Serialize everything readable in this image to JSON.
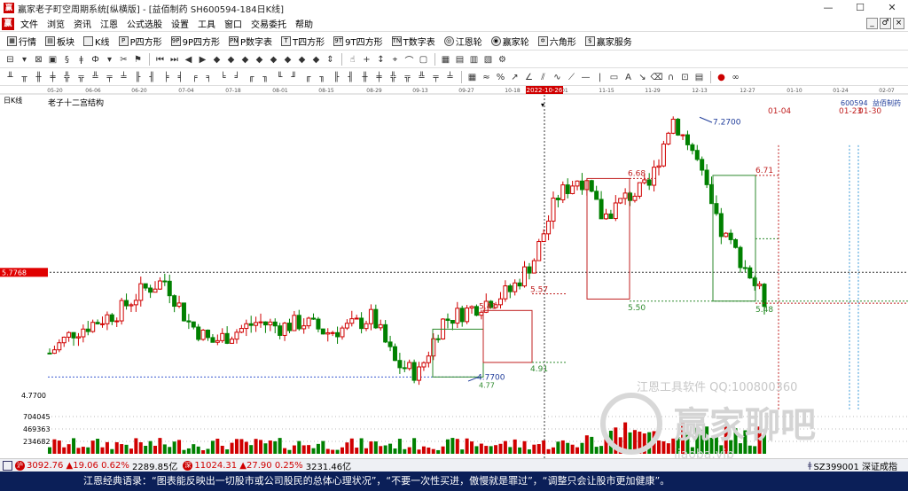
{
  "window": {
    "title": "赢家老子町空周期系统[纵横版] - [益佰制药  SH600594-184日K线]",
    "minimize": "—",
    "maximize": "☐",
    "close": "✕"
  },
  "menu": {
    "items": [
      "文件",
      "浏览",
      "资讯",
      "江恩",
      "公式选股",
      "设置",
      "工具",
      "窗口",
      "交易委托",
      "帮助"
    ],
    "mdi": [
      "_",
      "♂",
      "×"
    ]
  },
  "toolbar": {
    "items": [
      {
        "icon": "grid-icon",
        "glyph": "▦",
        "label": "行情"
      },
      {
        "icon": "blocks-icon",
        "glyph": "▤",
        "label": "板块"
      },
      {
        "icon": "kline-icon",
        "glyph": "ılı",
        "label": "K线"
      },
      {
        "icon": "p-square-icon",
        "glyph": "P",
        "label": "P四方形"
      },
      {
        "icon": "9p-square-icon",
        "glyph": "9P",
        "label": "9P四方形"
      },
      {
        "icon": "pn-table-icon",
        "glyph": "PN",
        "label": "P数字表"
      },
      {
        "icon": "t-square-icon",
        "glyph": "T",
        "label": "T四方形"
      },
      {
        "icon": "9t-square-icon",
        "glyph": "9T",
        "label": "9T四方形"
      },
      {
        "icon": "tn-table-icon",
        "glyph": "TN",
        "label": "T数字表"
      },
      {
        "icon": "gann-wheel-icon",
        "glyph": "◎",
        "label": "江恩轮"
      },
      {
        "icon": "winner-wheel-icon",
        "glyph": "◉",
        "label": "赢家轮"
      },
      {
        "icon": "hexagon-icon",
        "glyph": "✡",
        "label": "六角形"
      },
      {
        "icon": "service-icon",
        "glyph": "$",
        "label": "赢家服务"
      }
    ]
  },
  "chart": {
    "period_label": "日K线",
    "structure_label": "老子十二宫结构",
    "stock_code": "600594",
    "stock_name": "益佰制药",
    "cursor_date": "2022-10-26",
    "watermark_line1": "江恩工具软件  QQ:100800360",
    "watermark_line2": "赢家聊吧",
    "watermark_line3": "jiaoba.vip",
    "date_ticks": [
      "05-20",
      "06-06",
      "06-20",
      "07-04",
      "07-18",
      "08-01",
      "08-15",
      "08-29",
      "09-13",
      "09-27",
      "10-18",
      "11-01",
      "11-15",
      "11-29",
      "12-13",
      "12-27",
      "01-10",
      "01-24",
      "02-07"
    ],
    "left_price_tag": "5.7768",
    "price_low_label": "4.7700",
    "volume_ticks": [
      "704045",
      "469363",
      "234682"
    ],
    "labels": {
      "peak": "7.2700",
      "low_mark": "4.7700",
      "low_box": "4.77",
      "box1_top": "5.41",
      "box2_top": "5.57",
      "box2_bottom": "4.91",
      "box3_top": "6.68",
      "box3_bottom": "5.50",
      "box4_top": "6.71",
      "box4_bottom": "5.48",
      "date_a": "01-04",
      "date_b": "01-23",
      "date_c": "01-30"
    }
  },
  "chart_data": {
    "type": "candlestick",
    "title": "老子十二宫结构",
    "series": [
      {
        "name": "益佰制药",
        "ohlc_note": "daily K-line",
        "close_path": [
          5.0,
          5.2,
          5.3,
          5.4,
          5.6,
          5.7,
          5.3,
          5.1,
          5.2,
          5.3,
          5.25,
          5.3,
          5.2,
          5.25,
          5.35,
          4.9,
          4.8,
          5.3,
          5.4,
          5.5,
          5.6,
          5.9,
          6.5,
          6.7,
          6.3,
          6.5,
          6.6,
          7.27,
          6.9,
          6.2,
          5.9,
          5.5
        ]
      }
    ],
    "ylim": [
      4.5,
      7.4
    ]
  },
  "status": {
    "sh_index": "3092.76",
    "sh_change": "▲19.06",
    "sh_pct": "0.62%",
    "sh_amount": "2289.85亿",
    "sz_index": "11024.31",
    "sz_change": "▲27.90",
    "sz_pct": "0.25%",
    "sz_amount": "3231.46亿",
    "right_label": "SZ399001 深证成指"
  },
  "quote": "江恩经典语录：“图表能反映出一切股市或公司股民的总体心理状况”，“不要一次性买进，傲慢就是罪过”，“调整只会让股市更加健康”。"
}
